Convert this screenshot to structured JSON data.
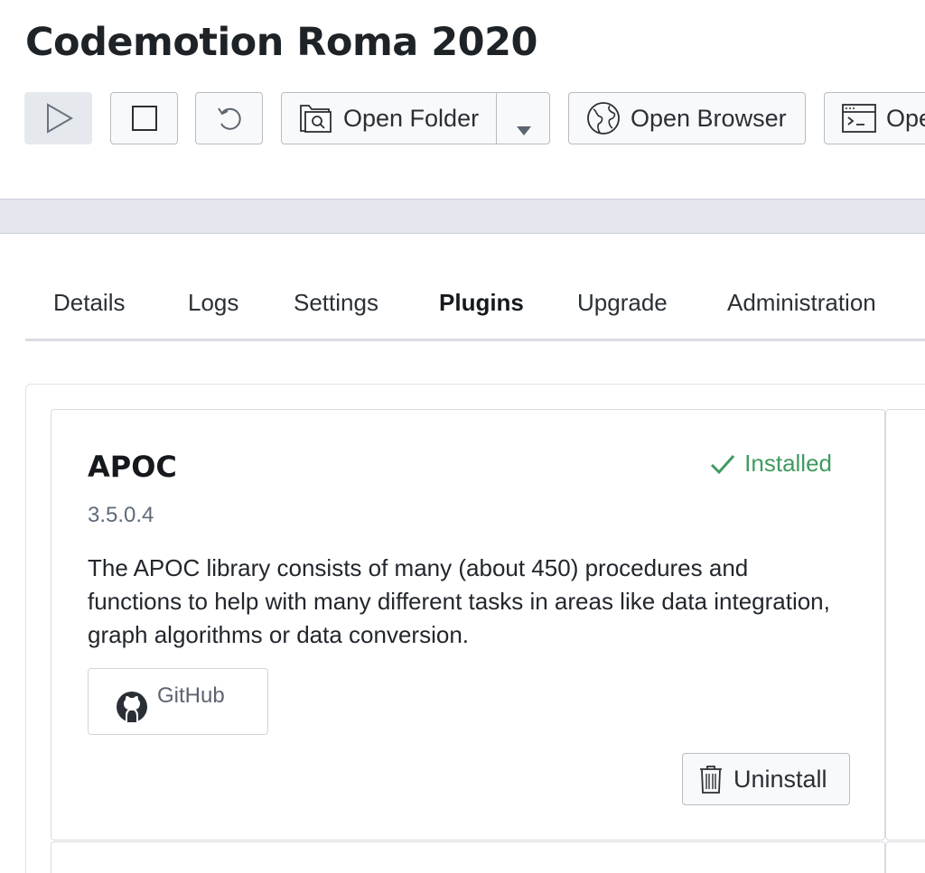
{
  "page_title": "Codemotion Roma 2020",
  "toolbar": {
    "start_icon": "play-icon",
    "stop_icon": "stop-icon",
    "restart_icon": "undo-icon",
    "open_folder_label": "Open Folder",
    "open_browser_label": "Open Browser",
    "open_terminal_label": "Ope"
  },
  "tabs": [
    {
      "label": "Details"
    },
    {
      "label": "Logs"
    },
    {
      "label": "Settings"
    },
    {
      "label": "Plugins",
      "active": true
    },
    {
      "label": "Upgrade"
    },
    {
      "label": "Administration"
    }
  ],
  "plugins": [
    {
      "name": "APOC",
      "status": "Installed",
      "version": "3.5.0.4",
      "description": "The APOC library consists of many (about 450) procedures and functions to help with many different tasks in areas like data integration, graph algorithms or data conversion.",
      "link_label": "GitHub",
      "action_label": "Uninstall"
    }
  ],
  "colors": {
    "installed": "#3f9b60",
    "band": "#e3e6ec",
    "border": "#b7bcc3"
  }
}
